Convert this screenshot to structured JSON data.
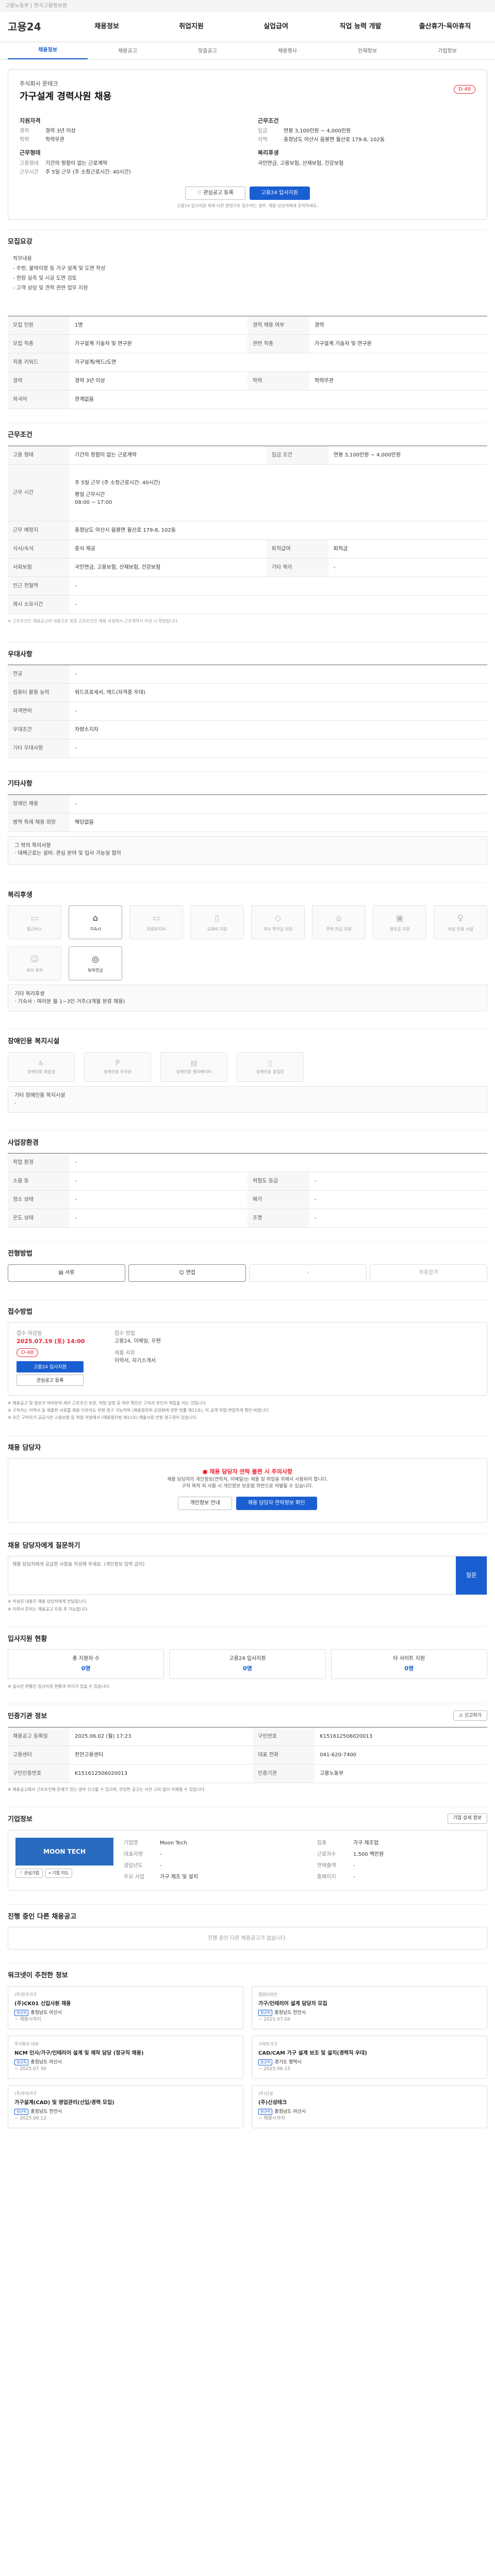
{
  "topbar": {
    "text": "고용노동부 | 한국고용정보원"
  },
  "gnb": {
    "logo": "고용24",
    "menu": [
      "채용정보",
      "취업지원",
      "실업급여",
      "직업 능력 개발",
      "출산휴가·육아휴직"
    ]
  },
  "subtabs": [
    "채용정보",
    "채용공고",
    "맞춤공고",
    "채용행사",
    "인재정보",
    "기업정보"
  ],
  "hero": {
    "company": "주식회사 문테크",
    "title": "가구설계 경력사원 채용",
    "dday": "D-48",
    "left_h": "지원자격",
    "left": [
      {
        "k": "경력",
        "v": "경력 3년 이상"
      },
      {
        "k": "학력",
        "v": "학력무관"
      }
    ],
    "left_h2": "근무형태",
    "left2": [
      {
        "k": "고용형태",
        "v": "기간의 정함이 없는 근로계약"
      },
      {
        "k": "근무시간",
        "v": "주 5일 근무 (주 소정근로시간: 40시간)"
      }
    ],
    "right_h": "근무조건",
    "right": [
      {
        "k": "임금",
        "v": "연봉 3,100만원 ~ 4,000만원"
      },
      {
        "k": "지역",
        "v": "충청남도 아산시 음봉면 월산로 179-8, 102동"
      }
    ],
    "right_h2": "복리후생",
    "right2": [
      {
        "k": "",
        "v": "국민연금, 고용보험, 산재보험, 건강보험"
      }
    ],
    "btn_save": "관심공고 등록",
    "btn_apply": "고용24 입사지원",
    "note": "고용24 입사지원 외에 다른 방법으로 접수하는 경우, 채용 담당자에게 문의하세요."
  },
  "sections": {
    "recruit": "모집요강",
    "recruit_label": "직무내용",
    "recruit_text": [
      "직무내용",
      "- 주방, 붙박이장 등 가구 설계 및 도면 작성",
      "- 현장 실측 및 시공 도면 검토",
      "- 고객 상담 및 견적 관련 업무 지원"
    ],
    "recruit_tb": [
      [
        "모집 인원",
        "1명",
        "경력 채용 여부",
        "경력"
      ],
      [
        "모집 직종",
        "가구설계 기술자 및 연구원",
        "관련 직종",
        "가구설계 기술자 및 연구원"
      ],
      [
        "직종 키워드",
        "가구설계/캐드/도면",
        null,
        null
      ],
      [
        "경력",
        "경력 3년 이상",
        "학력",
        "학력무관"
      ],
      [
        "외국어",
        "관계없음",
        null,
        null
      ]
    ],
    "work": "근무조건",
    "work_tb": [
      [
        "고용 형태",
        "기간의 정함이 없는 근로계약",
        "임금 조건",
        "연봉 3,100만원 ~ 4,000만원"
      ],
      [
        "근무 시간",
        "주 5일 근무 (주 소정근로시간: 40시간)",
        null,
        null
      ],
      [
        "근무 예정지",
        "충청남도 아산시 음봉면 월산로 179-8, 102동",
        null,
        null
      ],
      [
        "식사/숙식",
        "중식 제공",
        "퇴직급여",
        "퇴직금"
      ],
      [
        "사회보험",
        "국민연금, 고용보험, 산재보험, 건강보험",
        "기타 복리",
        "-"
      ],
      [
        "인근 전철역",
        "-",
        null,
        null
      ],
      [
        "제시 소요시간",
        "-",
        null,
        null
      ]
    ],
    "work_hours": "평일 근무시간\n08:00 ~ 17:00",
    "work_note": "※ 근로조건은 채용공고의 내용으로 최종 근로조건은 채용 과정에서 근로계약서 작성 시 확정됩니다.",
    "prefer": "우대사항",
    "prefer_tb": [
      [
        "전공",
        "-"
      ],
      [
        "컴퓨터 활용 능력",
        "워드프로세서, 캐드(자격증 우대)"
      ],
      [
        "자격면허",
        "-"
      ],
      [
        "우대조건",
        "차량소지자"
      ],
      [
        "기타 우대사항",
        "-"
      ]
    ],
    "etc": "기타사항",
    "etc_tb": [
      [
        "장애인 채용",
        "-"
      ],
      [
        "병역 특례 채용 희망",
        "해당없음"
      ]
    ],
    "etc_box": "그 밖의 특이사항\n· 대체근로는 설비: 관심 분야 및 입사 가능일 협의",
    "welfare": "복리후생",
    "welfare_items": [
      "통근버스",
      "기숙사",
      "차량유지비",
      "교육비 지원",
      "자녀 학자금 지원",
      "주택 자금 지원",
      "경조금 지원",
      "여성 전용 시설",
      "육아 휴직",
      "퇴직연금"
    ],
    "welfare_active": [
      1,
      9
    ],
    "welfare_box": "기타 복리후생\n· 기숙사 : 여러분 월 1~3인 거주(3개월 분류 채용)",
    "disab": "장애인용 복지시설",
    "disab_items": [
      "장애인용 화장실",
      "장애인용 주차장",
      "장애인용 엘리베이터",
      "장애인용 출입문"
    ],
    "disab_box": "기타 장애인용 복지시설\n-",
    "loc": "사업장환경",
    "loc_tb": [
      [
        "작업 환경",
        "-",
        null,
        null
      ],
      [
        "소음 등",
        "-",
        "위험도 등급",
        "-"
      ],
      [
        "청소 상태",
        "-",
        "배가",
        "-"
      ],
      [
        "온도 상태",
        "-",
        "조명",
        "-"
      ]
    ],
    "steps": "전형방법",
    "steps_items": [
      "서류",
      "면접",
      "",
      "최종합격"
    ],
    "apply": "접수방법",
    "apply_deadline_label": "접수 마감일",
    "apply_deadline": "2025.07.19 (토) 14:00",
    "apply_dday": "D-48",
    "apply_btn1": "고용24 입사지원",
    "apply_btn2": "관심공고 등록",
    "apply_method_label": "접수 방법",
    "apply_method": "고용24, 이메일, 우편",
    "apply_doc_label": "제출 서류",
    "apply_doc": "이력서, 자기소개서",
    "apply_notes": [
      "※ 채용공고 및 정보가 여러분의 세부 근로조건 보장, 직업 설명 등 여부 확인은 구직자 본인이 책임을 지는 것입니다.",
      "※ 구직자는 이력서 등 제출한 서류를 채용 이후라도 반환 청구 가능하며 (채용절차의 공정화에 관한 법률 제11조), 미 공개 직업 면밀하게 확인 바랍니다.",
      "※ 모든 구직자가 공공기관 고용보험 등 취업 과정에서 (채용절차법 제11조) 제출서류 반환 청구권이 있습니다."
    ],
    "hr": "채용 담당자",
    "hr_warn": "채용 담당자 연락 불편 시 주의사항",
    "hr_text": [
      "채용 담당자의 개인정보(연락처, 이메일)는 채용 및 취업을 위해서 사용되어 합니다.",
      "구직 목적 외 사용 시 개인정보 보호법 위반으로 처벌될 수 있습니다."
    ],
    "hr_btn1": "개인정보 안내",
    "hr_btn2": "채용 담당자 연락정보 확인",
    "inq": "채용 담당자에게 질문하기",
    "inq_placeholder": "채용 담당자에게 궁금한 사항을 작성해 주세요. (개인정보 입력 금지)",
    "inq_btn": "질문",
    "inq_notes": [
      "※ 작성된 내용은 채용 담당자에게 전달됩니다.",
      "※ 이력서 문의는 채용공고 지원 후 가능합니다."
    ],
    "stat": "입사지원 현황",
    "stat_items": [
      {
        "label": "총 지원자 수",
        "val": "0명"
      },
      {
        "label": "고용24 입사지원",
        "val": "0명"
      },
      {
        "label": "타 사이트 지원",
        "val": "0명"
      }
    ],
    "stat_note": "※ 실시간 현황은 입사지원 현황과 차이가 있을 수 있습니다.",
    "info": "인증기관 정보",
    "info_tb": [
      [
        "채용공고 등록일",
        "2025.06.02 (월) 17:23",
        "구인번호",
        "K151612506020013"
      ],
      [
        "고용센터",
        "천안고용센터",
        "대표 전화",
        "041-620-7400"
      ],
      [
        "구인인증번호",
        "K151612506020013",
        "인증기관",
        "고용노동부"
      ]
    ],
    "info_btn": "신고하기",
    "info_note": "※ 채용공고에서 근로조건에 문제가 있는 경우 신고할 수 있으며, 부당한 공고는 사전 고지 없이 삭제될 수 있습니다.",
    "company": "기업정보",
    "company_logo": "MOON TECH",
    "company_tb": [
      [
        "기업명",
        "Moon Tech",
        "업종",
        "가구 제조업"
      ],
      [
        "대표자명",
        "-",
        "근로자수",
        "1,500 백만원"
      ],
      [
        "설립년도",
        "-",
        "연매출액",
        "-"
      ],
      [
        "주요 사업",
        "가구 제조 및 설치",
        "홈페이지",
        "-"
      ]
    ],
    "company_btn": "기업 상세 정보",
    "company_btn2": "관심기업",
    "company_btn3": "기업 지도",
    "company_btn4": "기업 리뷰",
    "other": "진행 중인 다른 채용공고",
    "other_empty": "진행 중인 다른 채용공고가 없습니다.",
    "rec": "워크넷이 추천한 정보",
    "rec_cards": [
      {
        "company": "(주)한국가구",
        "title": "(주)CK01 신입사원 채용",
        "tag": "정규직",
        "loc": "충청남도 아산시",
        "date": "~ 채용시까지"
      },
      {
        "company": "엠원디자인",
        "title": "가구/인테리어 설계 담당자 모집",
        "tag": "정규직",
        "loc": "충청남도 천안시",
        "date": "~ 2025.07.04"
      },
      {
        "company": "주식회사 대성",
        "title": "NCM 인사/가구/인테리어 설계 및 제작 담당 (정규직 채용)",
        "tag": "정규직",
        "loc": "충청남도 아산시",
        "date": "~ 2025.07.30"
      },
      {
        "company": "스마트가구",
        "title": "CAD/CAM 가구 설계 보조 및 설치(경력직 우대)",
        "tag": "정규직",
        "loc": "경기도 평택시",
        "date": "~ 2025.06.15"
      },
      {
        "company": "(주)우리가구",
        "title": "가구설계(CAD) 및 영업관리(신입/경력 모집)",
        "tag": "정규직",
        "loc": "충청남도 천안시",
        "date": "~ 2025.06.12"
      },
      {
        "company": "(주)신성",
        "title": "(주)신성테크",
        "tag": "정규직",
        "loc": "충청남도 아산시",
        "date": "~ 채용시까지"
      }
    ]
  }
}
